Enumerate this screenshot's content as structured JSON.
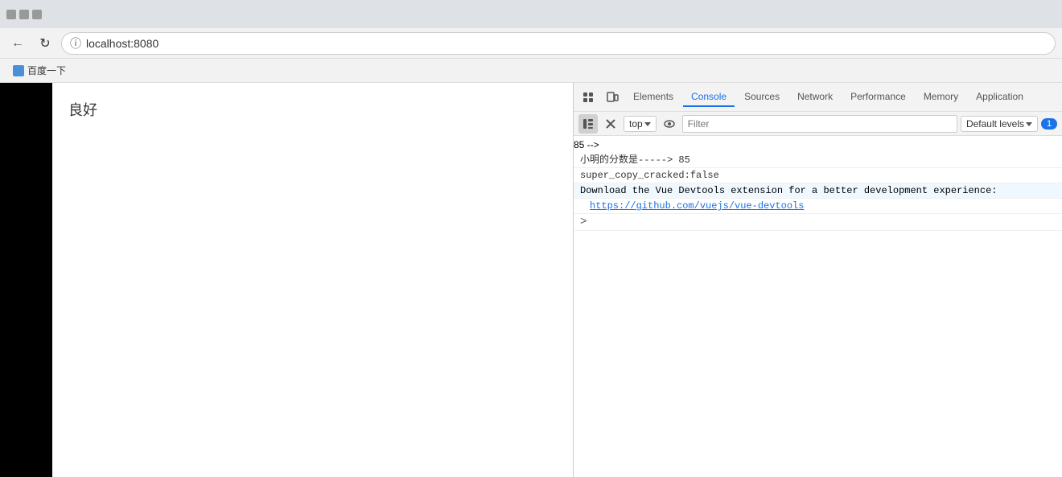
{
  "browser": {
    "url": "localhost:8080",
    "back_btn": "←",
    "refresh_btn": "↻"
  },
  "bookmarks": [
    {
      "label": "百度一下",
      "icon": "baidu"
    }
  ],
  "page": {
    "content": "良好"
  },
  "devtools": {
    "tabs": [
      {
        "label": "Elements",
        "active": false
      },
      {
        "label": "Console",
        "active": true
      },
      {
        "label": "Sources",
        "active": false
      },
      {
        "label": "Network",
        "active": false
      },
      {
        "label": "Performance",
        "active": false
      },
      {
        "label": "Memory",
        "active": false
      },
      {
        "label": "Application",
        "active": false
      }
    ],
    "console": {
      "top_label": "top",
      "filter_placeholder": "Filter",
      "default_levels_label": "Default levels",
      "badge_count": "1",
      "output": [
        {
          "type": "log",
          "text": "小明的分数是-----> 85",
          "linenum": ""
        },
        {
          "type": "log",
          "text": "super_copy_cracked:false",
          "linenum": ""
        },
        {
          "type": "info",
          "text": "Download the Vue Devtools extension for a better development experience:",
          "linenum": ""
        },
        {
          "type": "link",
          "text": "https://github.com/vuejs/vue-devtools",
          "href": "https://github.com/vuejs/vue-devtools",
          "linenum": ""
        },
        {
          "type": "prompt",
          "text": ">",
          "linenum": ""
        }
      ]
    }
  }
}
